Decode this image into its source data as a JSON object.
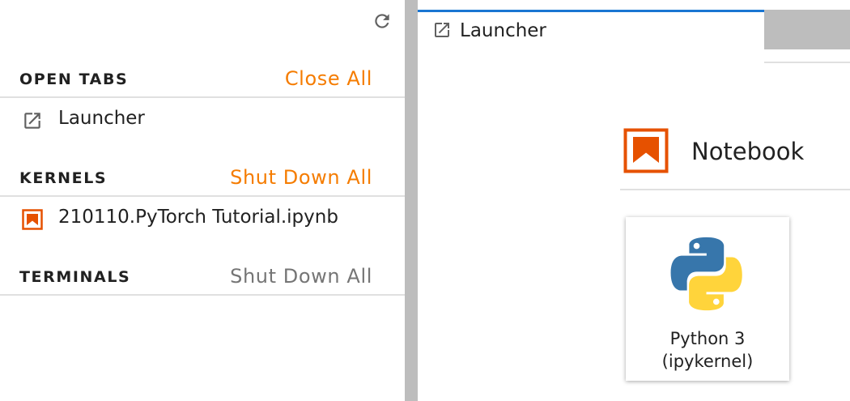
{
  "colors": {
    "accent_orange": "#f57c00",
    "kernel_icon_orange": "#e65100",
    "tab_active_border": "#1976d2",
    "muted_text": "#757575",
    "splitter_gray": "#bdbdbd"
  },
  "sidebar": {
    "refresh_icon": "refresh-icon",
    "open_tabs": {
      "title": "OPEN TABS",
      "action": "Close All",
      "items": [
        {
          "icon": "launch-icon",
          "label": "Launcher"
        }
      ]
    },
    "kernels": {
      "title": "KERNELS",
      "action": "Shut Down All",
      "items": [
        {
          "icon": "notebook-icon",
          "label": "210110.PyTorch Tutorial.ipynb"
        }
      ]
    },
    "terminals": {
      "title": "TERMINALS",
      "action": "Shut Down All",
      "items": []
    }
  },
  "main": {
    "tabs": [
      {
        "icon": "launch-icon",
        "label": "Launcher",
        "active": true
      }
    ],
    "launcher": {
      "section": {
        "icon": "notebook-icon",
        "title": "Notebook"
      },
      "kernels": [
        {
          "icon": "python-logo-icon",
          "line1": "Python 3",
          "line2": "(ipykernel)"
        }
      ]
    }
  }
}
